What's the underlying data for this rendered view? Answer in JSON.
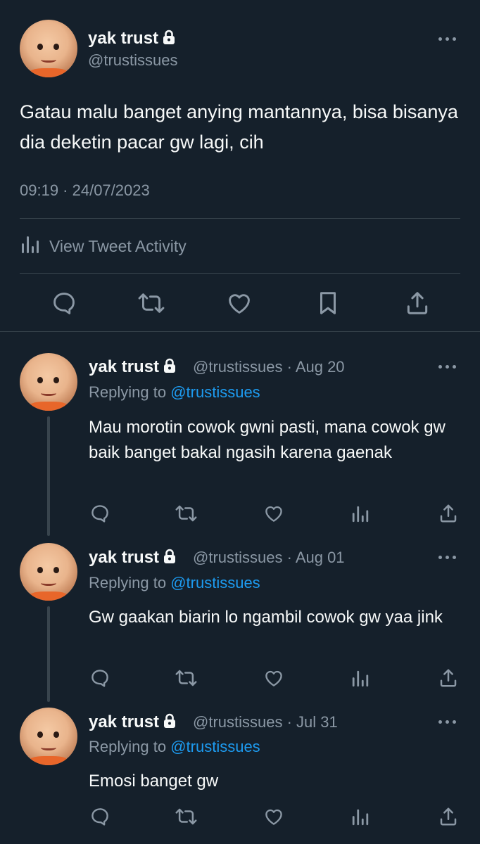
{
  "main_tweet": {
    "name": "yak trust",
    "handle": "@trustissues",
    "text": "Gatau malu banget anying mantannya, bisa bisanya dia deketin pacar gw lagi, cih",
    "timestamp": "09:19 · 24/07/2023",
    "activity_label": "View Tweet Activity",
    "actions": [
      "reply-icon",
      "retweet-icon",
      "like-icon",
      "bookmark-icon",
      "share-icon"
    ]
  },
  "replies": [
    {
      "name": "yak trust",
      "meta": "@trustissues · Aug 20",
      "replying_label": "Replying to",
      "replying_handle": "@trustissues",
      "text": "Mau morotin cowok gwni pasti, mana cowok gw baik banget bakal ngasih karena gaenak"
    },
    {
      "name": "yak trust",
      "meta": "@trustissues · Aug 01",
      "replying_label": "Replying to",
      "replying_handle": "@trustissues",
      "text": "Gw gaakan biarin lo ngambil cowok gw yaa jink"
    },
    {
      "name": "yak trust",
      "meta": "@trustissues · Jul 31",
      "replying_label": "Replying to",
      "replying_handle": "@trustissues",
      "text": "Emosi banget gw"
    }
  ],
  "colors": {
    "background": "#15202b",
    "text": "#f7f9f9",
    "secondary": "#8b98a5",
    "accent": "#1d9bf0",
    "divider": "#38444d"
  }
}
